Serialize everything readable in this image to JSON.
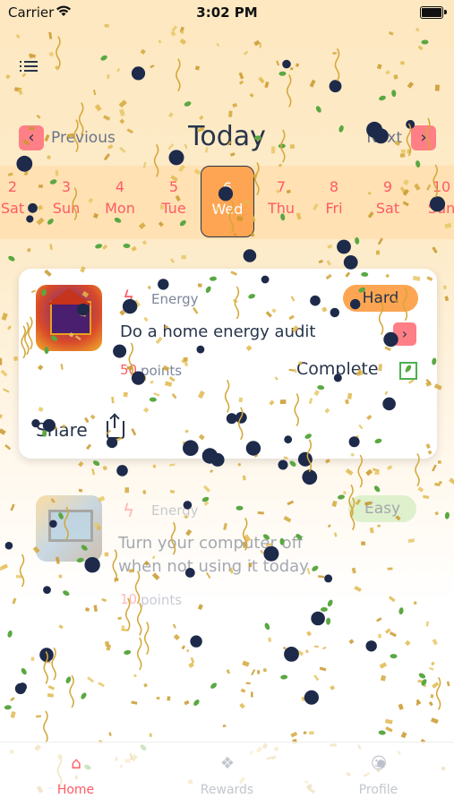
{
  "status_bar": {
    "carrier": "Carrier",
    "time": "3:02 PM"
  },
  "header": {
    "title": "Today",
    "previous_label": "Previous",
    "next_label": "Next"
  },
  "week": {
    "days": [
      {
        "date": "2",
        "weekday": "Sat"
      },
      {
        "date": "3",
        "weekday": "Sun"
      },
      {
        "date": "4",
        "weekday": "Mon"
      },
      {
        "date": "5",
        "weekday": "Tue"
      },
      {
        "date": "6",
        "weekday": "Wed",
        "selected": true
      },
      {
        "date": "7",
        "weekday": "Thu"
      },
      {
        "date": "8",
        "weekday": "Fri"
      },
      {
        "date": "9",
        "weekday": "Sat"
      },
      {
        "date": "10",
        "weekday": "Sun"
      }
    ]
  },
  "tasks": [
    {
      "category": "Energy",
      "difficulty": "Hard",
      "title": "Do a home energy audit",
      "points": "50",
      "points_label": "points",
      "complete_label": "Complete",
      "share_label": "Share",
      "thumb_caption": "home energy audit"
    },
    {
      "category": "Energy",
      "difficulty": "Easy",
      "title_line1": "Turn your computer off",
      "title_line2": "when not using it today",
      "points": "10",
      "points_label": "points"
    }
  ],
  "tab_bar": {
    "tabs": [
      {
        "label": "Home",
        "icon": "home-icon",
        "active": true
      },
      {
        "label": "Rewards",
        "icon": "gift-icon",
        "active": false
      },
      {
        "label": "Profile",
        "icon": "profile-icon",
        "active": false
      }
    ]
  },
  "colors": {
    "accent": "#ff5a64",
    "hard": "#fda552",
    "easy": "#b5e39b",
    "text": "#27344a"
  }
}
